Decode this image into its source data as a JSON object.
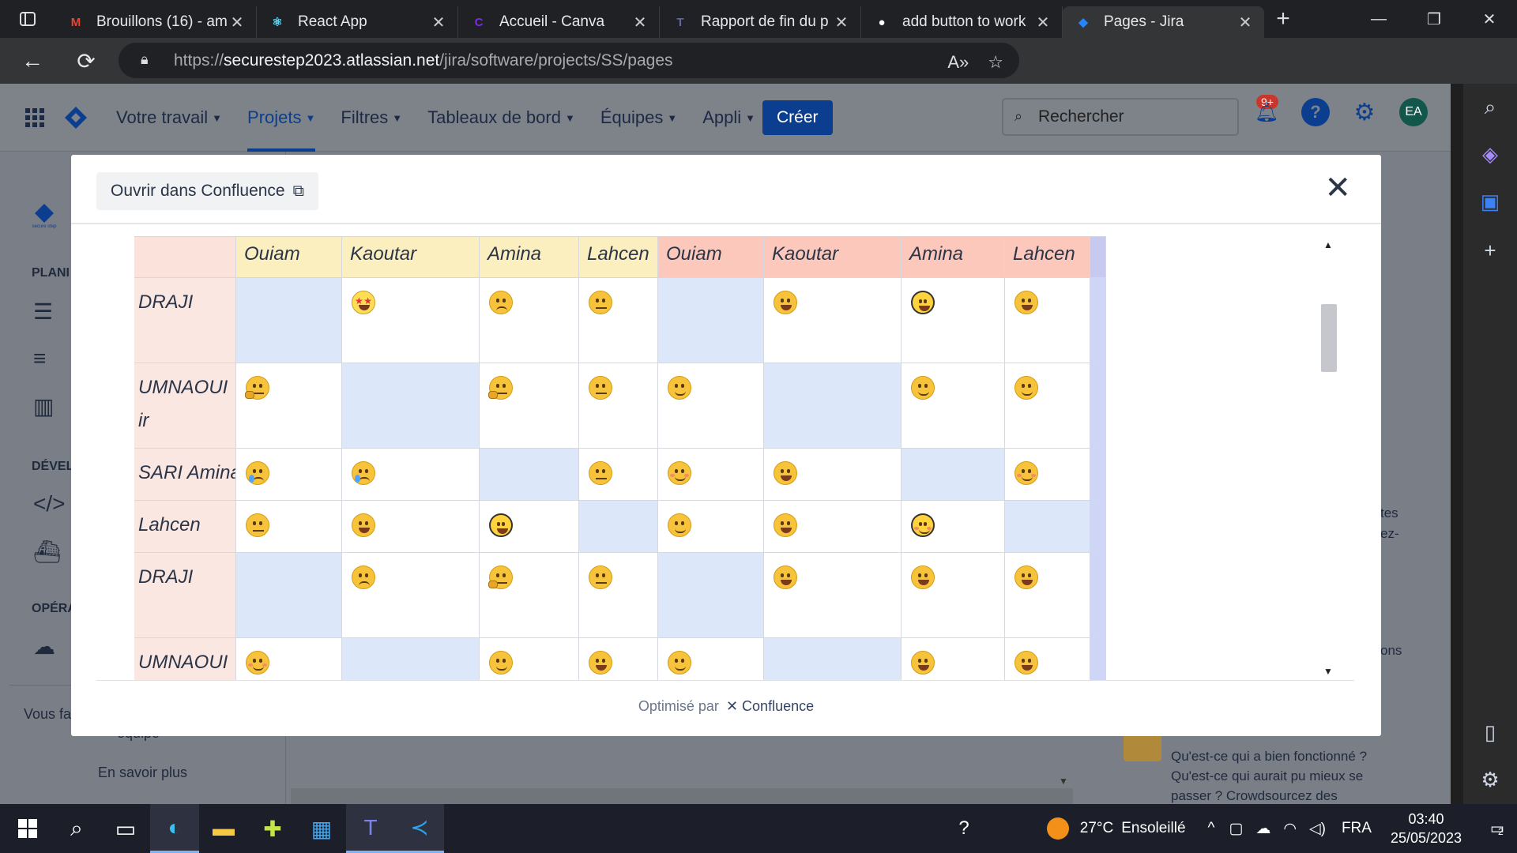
{
  "browser": {
    "tabs": [
      {
        "title": "Brouillons (16) - am",
        "icon": "gmail-icon",
        "color": "#ea4335",
        "glyph": "M"
      },
      {
        "title": "React App",
        "icon": "react-icon",
        "color": "#61dafb",
        "glyph": "⚛"
      },
      {
        "title": "Accueil - Canva",
        "icon": "canva-icon",
        "color": "#7d2ae8",
        "glyph": "C"
      },
      {
        "title": "Rapport de fin du p",
        "icon": "teams-icon",
        "color": "#6264a7",
        "glyph": "T"
      },
      {
        "title": "add button to work",
        "icon": "github-icon",
        "color": "#ffffff",
        "glyph": "●"
      },
      {
        "title": "Pages - Jira",
        "icon": "jira-icon",
        "color": "#2684ff",
        "glyph": "◆"
      }
    ],
    "url_prefix": "https://",
    "url_host": "securestep2023.atlassian.net",
    "url_path": "/jira/software/projects/SS/pages"
  },
  "jira": {
    "nav": [
      {
        "label": "Votre travail"
      },
      {
        "label": "Projets"
      },
      {
        "label": "Filtres"
      },
      {
        "label": "Tableaux de bord"
      },
      {
        "label": "Équipes"
      },
      {
        "label": "Appli"
      }
    ],
    "create_label": "Créer",
    "search_placeholder": "Rechercher",
    "notif_badge": "9+",
    "avatar_initials": "EA",
    "sidebar": {
      "section1": "PLANI",
      "section2": "DÉVEL",
      "section3": "OPÉRA",
      "footer_text": "Vous fa",
      "team_text": "équipe",
      "learn_more": "En savoir plus"
    },
    "behind": {
      "right1": "tes",
      "right2": "ez-",
      "right3": "ons",
      "retro_line1": "Qu'est-ce qui a bien fonctionné ?",
      "retro_line2": "Qu'est-ce qui aurait pu mieux se",
      "retro_line3": "passer ? Crowdsourcez des"
    }
  },
  "modal": {
    "open_label": "Ouvrir dans Confluence",
    "footer_prefix": "Optimisé par",
    "footer_brand": "Confluence",
    "columns": [
      {
        "label": "Ouiam",
        "tone": "y"
      },
      {
        "label": "Kaoutar",
        "tone": "y"
      },
      {
        "label": "Amina",
        "tone": "y"
      },
      {
        "label": "Lahcen",
        "tone": "y"
      },
      {
        "label": "Ouiam",
        "tone": "r"
      },
      {
        "label": "Kaoutar",
        "tone": "r"
      },
      {
        "label": "Amina",
        "tone": "r"
      },
      {
        "label": "Lahcen",
        "tone": "r"
      }
    ],
    "rows": [
      {
        "name1": "DRAJI",
        "name2": "",
        "h": 108,
        "cells": [
          "blue:",
          ":star",
          ":confused",
          ":neutral",
          "blue:",
          ":grin",
          ":smile-o",
          ":grin"
        ]
      },
      {
        "name1": "UMNAOUI",
        "name2": "ir",
        "h": 108,
        "cells": [
          ":think",
          "blue:",
          ":think",
          ":neutral",
          ":slight",
          "blue:",
          ":slight",
          ":slight"
        ]
      },
      {
        "name1": "SARI Amina",
        "name2": "",
        "h": 66,
        "cells": [
          ":cry",
          ":tired",
          "blue:",
          ":neutral",
          ":blush",
          ":grin",
          "blue:",
          ":blush"
        ]
      },
      {
        "name1": "Lahcen",
        "name2": "",
        "h": 66,
        "cells": [
          ":neutral",
          ":grin",
          ":grin-o",
          "blue:",
          ":slight",
          ":grin",
          ":relieved-o",
          "blue:"
        ]
      },
      {
        "name1": "DRAJI",
        "name2": "",
        "h": 108,
        "cells": [
          "blue:",
          ":sad",
          ":think",
          ":unamused",
          "blue:",
          ":grin",
          ":grin",
          ":grin"
        ]
      },
      {
        "name1": "UMNAOUI",
        "name2": "",
        "h": 66,
        "cells": [
          ":blush",
          "blue:",
          ":slight",
          ":grin",
          ":slight",
          "blue:",
          ":grin",
          ":grin"
        ]
      }
    ]
  },
  "taskbar": {
    "weather_temp": "27°C",
    "weather_text": "Ensoleillé",
    "language": "FRA",
    "time": "03:40",
    "date": "25/05/2023",
    "notif_count": "2"
  }
}
